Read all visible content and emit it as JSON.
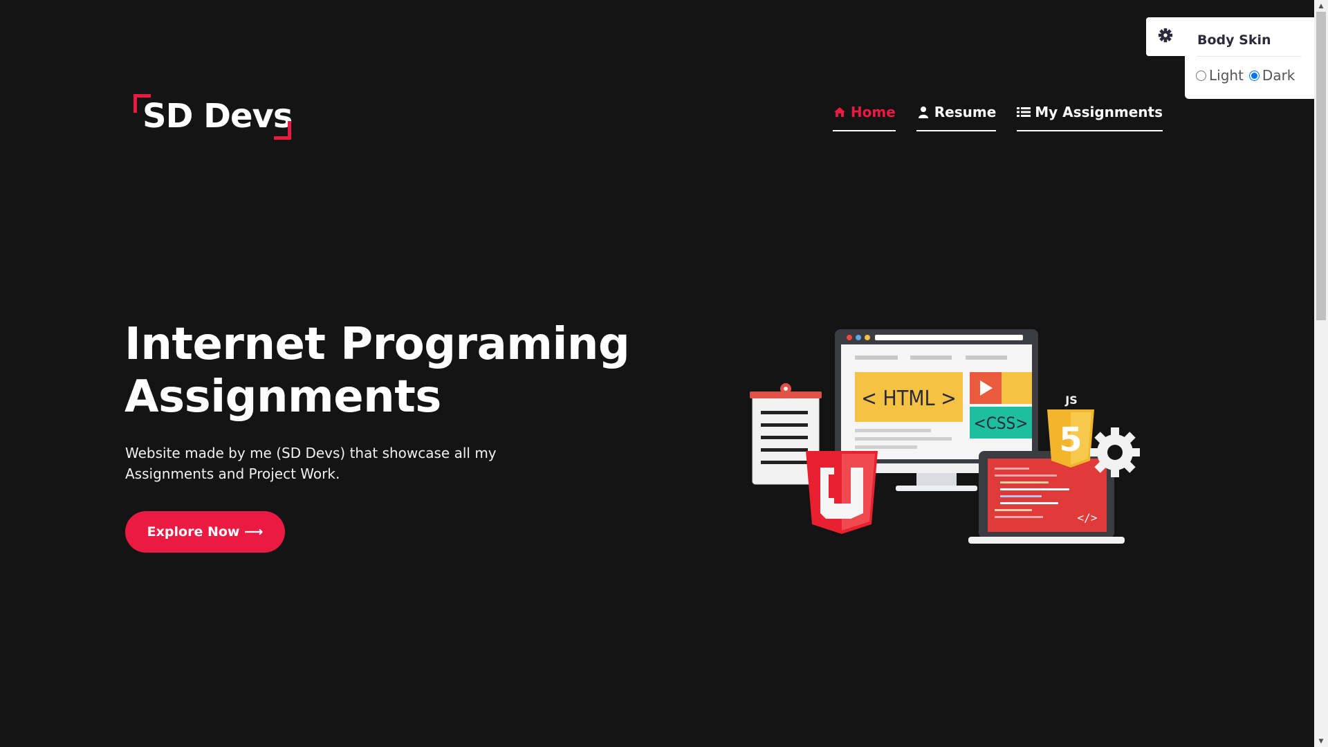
{
  "brand": {
    "name": "SD Devs",
    "accent_color": "#ea1a42",
    "background_color": "#151415"
  },
  "nav": {
    "items": [
      {
        "label": "Home",
        "icon": "home-icon",
        "active": true
      },
      {
        "label": "Resume",
        "icon": "user-icon",
        "active": false
      },
      {
        "label": "My Assignments",
        "icon": "list-icon",
        "active": false
      }
    ]
  },
  "hero": {
    "title_line1": "Internet Programing",
    "title_line2": "Assignments",
    "text_line1": "Website made by me (SD Devs) that showcase all my",
    "text_line2": "Assignments and Project Work.",
    "cta_label": "Explore Now ⟶"
  },
  "illustration": {
    "html_label": "< HTML >",
    "css_label": "<CSS>",
    "js_label": "JS",
    "html5_badge": "5",
    "code_tag": "</>"
  },
  "skin_panel": {
    "title": "Body Skin",
    "options": [
      {
        "label": "Light",
        "checked": false
      },
      {
        "label": "Dark",
        "checked": true
      }
    ]
  }
}
